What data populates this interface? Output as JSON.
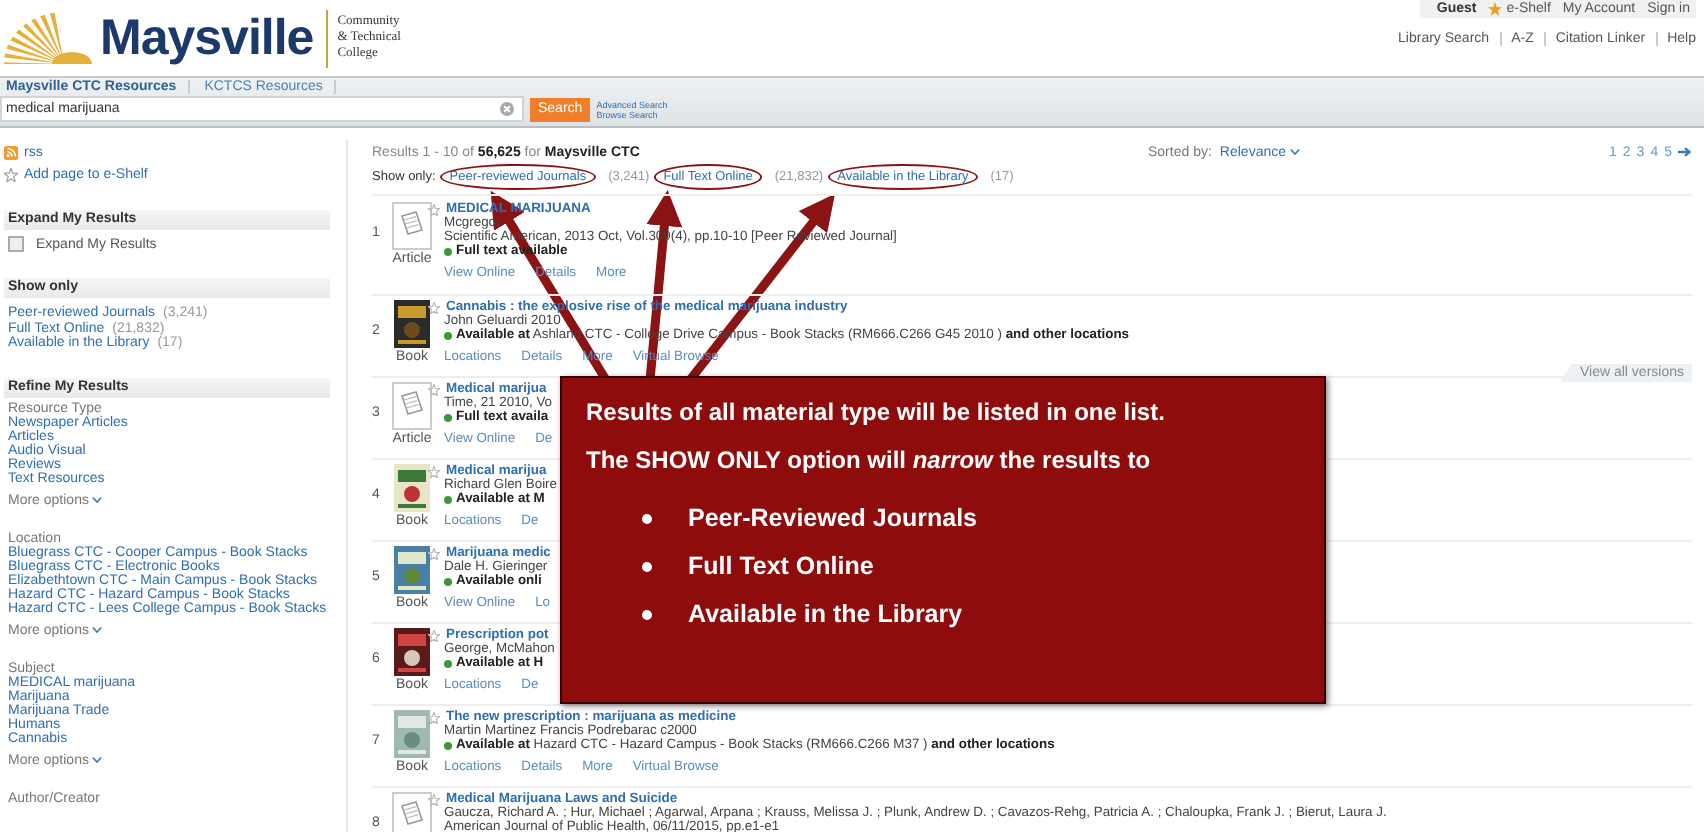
{
  "header": {
    "logo": {
      "name": "Maysville",
      "tagline": [
        "Community",
        "& Technical",
        "College"
      ]
    },
    "user_links": [
      {
        "kind": "user",
        "label": "Guest"
      },
      {
        "kind": "shelf",
        "label": "e-Shelf"
      },
      {
        "kind": "link",
        "label": "My Account"
      },
      {
        "kind": "link",
        "label": "Sign in"
      }
    ],
    "nav_links": [
      "Library Search",
      "A-Z",
      "Citation Linker",
      "Help"
    ]
  },
  "search": {
    "tabs": [
      {
        "label": "Maysville CTC Resources",
        "selected": true
      },
      {
        "label": "KCTCS Resources",
        "selected": false
      }
    ],
    "query": "medical marijuana",
    "button": "Search",
    "links": [
      "Advanced Search",
      "Browse Search"
    ]
  },
  "sidebar": {
    "actions": [
      {
        "kind": "rss",
        "label": "rss"
      },
      {
        "kind": "shelf",
        "label": "Add page to e-Shelf"
      }
    ],
    "sections": [
      {
        "kind": "checkbox",
        "title": "Expand My Results",
        "items": [
          {
            "label": "Expand My Results",
            "checked": false
          }
        ]
      },
      {
        "kind": "links",
        "title": "Show only",
        "items": [
          {
            "label": "Peer-reviewed Journals",
            "count": "(3,241)"
          },
          {
            "label": "Full Text Online",
            "count": "(21,832)"
          },
          {
            "label": "Available in the Library",
            "count": "(17)"
          }
        ]
      },
      {
        "kind": "facets",
        "title": "Refine My Results",
        "groups": [
          {
            "heading": "Resource Type",
            "items": [
              "Newspaper Articles",
              "Articles",
              "Audio Visual",
              "Reviews",
              "Text Resources"
            ],
            "more": "More options"
          },
          {
            "heading": "Location",
            "items": [
              "Bluegrass CTC - Cooper Campus - Book Stacks",
              "Bluegrass CTC - Electronic Books",
              "Elizabethtown CTC - Main Campus - Book Stacks",
              "Hazard CTC - Hazard Campus - Book Stacks",
              "Hazard CTC - Lees College Campus - Book Stacks"
            ],
            "more": "More options"
          },
          {
            "heading": "Subject",
            "items": [
              "MEDICAL marijuana",
              "Marijuana",
              "Marijuana Trade",
              "Humans",
              "Cannabis"
            ],
            "more": "More options"
          },
          {
            "heading": "Author/Creator"
          }
        ]
      }
    ]
  },
  "results": {
    "summary": "Results 1 - 10 of **56,625** for **Maysville CTC**",
    "sort_label": "Sorted by:",
    "sort_value": "Relevance",
    "pages": [
      "1",
      "2",
      "3",
      "4",
      "5"
    ],
    "show_only_label": "Show only:",
    "filters": [
      {
        "label": "Peer-reviewed Journals",
        "count": "(3,241)"
      },
      {
        "label": "Full Text Online",
        "count": "(21,832)"
      },
      {
        "label": "Available in the Library",
        "count": "(17)"
      }
    ],
    "view_all": "View all versions",
    "items": [
      {
        "number": "1",
        "kind": "article",
        "type": "Article",
        "title": "MEDICAL MARIJUANA",
        "author": "Mcgregor",
        "source": "Scientific American, 2013 Oct, Vol.309(4), pp.10-10 [Peer Reviewed Journal]",
        "availability": "**Full text available**",
        "links": [
          "View Online",
          "Details",
          "More"
        ]
      },
      {
        "number": "2",
        "kind": "book",
        "type": "Book",
        "title": "Cannabis : the explosive rise of the medical marijuana industry",
        "author": "John Geluardi 2010",
        "availability": "**Available at** Ashland CTC - College Drive Campus - Book Stacks  (RM666.C266 G45 2010 ) **and other locations**",
        "links": [
          "Locations",
          "Details",
          "More",
          "Virtual Browse"
        ]
      },
      {
        "number": "3",
        "kind": "article",
        "type": "Article",
        "title": "Medical marijua",
        "author": "Time, 21 2010, Vo",
        "availability": "**Full text availa**",
        "links": [
          "View Online",
          "De"
        ]
      },
      {
        "number": "4",
        "kind": "book",
        "type": "Book",
        "title": "Medical marijua",
        "author": "Richard Glen Boire",
        "availability": "**Available at M**",
        "links": [
          "Locations",
          "De"
        ]
      },
      {
        "number": "5",
        "kind": "book",
        "type": "Book",
        "title": "Marijuana medic",
        "author": "Dale H. Gieringer",
        "availability": "**Available onli**",
        "links": [
          "View Online",
          "Lo"
        ]
      },
      {
        "number": "6",
        "kind": "book",
        "type": "Book",
        "title": "Prescription pot",
        "author": "George, McMahon",
        "availability": "**Available at H**",
        "links": [
          "Locations",
          "De"
        ]
      },
      {
        "number": "7",
        "kind": "book",
        "type": "Book",
        "title": "The new prescription : marijuana as medicine",
        "author": "Martin Martinez Francis Podrebarac c2000",
        "availability": "**Available at** Hazard CTC - Hazard Campus - Book Stacks  (RM666.C266 M37 ) **and other locations**",
        "links": [
          "Locations",
          "Details",
          "More",
          "Virtual Browse"
        ]
      },
      {
        "number": "8",
        "kind": "article",
        "title": "Medical Marijuana Laws and Suicide",
        "author": "Gaucza, Richard A. ; Hur, Michael ; Agarwal, Arpana ; Krauss, Melissa J. ; Plunk, Andrew D. ; Cavazos-Rehg, Patricia A. ; Chaloupka, Frank J. ; Bierut, Laura J.",
        "source": "American Journal of Public Health, 06/11/2015, pp.e1-e1"
      }
    ]
  },
  "callout": {
    "lines": [
      "Results of all material type will be listed in one list.",
      "The SHOW ONLY option will *narrow* the results to"
    ],
    "bullets": [
      "Peer-Reviewed Journals",
      "Full Text Online",
      "Available in the Library"
    ]
  }
}
